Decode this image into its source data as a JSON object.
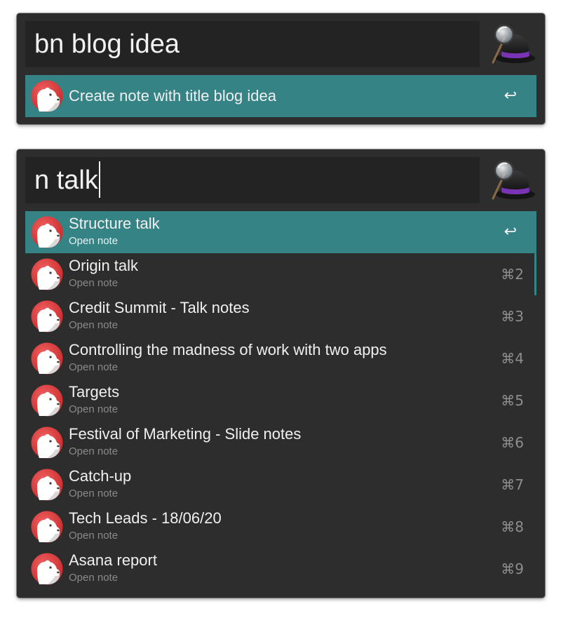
{
  "panel1": {
    "query": "bn blog idea",
    "result": {
      "title": "Create note with title blog idea",
      "shortcut": "↩"
    }
  },
  "panel2": {
    "query": "n talk",
    "results": [
      {
        "title": "Structure talk",
        "subtitle": "Open note",
        "shortcut": "↩",
        "selected": true
      },
      {
        "title": "Origin talk",
        "subtitle": "Open note",
        "shortcut": "⌘2"
      },
      {
        "title": "Credit Summit - Talk notes",
        "subtitle": "Open note",
        "shortcut": "⌘3"
      },
      {
        "title": "Controlling the madness of work with two apps",
        "subtitle": "Open note",
        "shortcut": "⌘4"
      },
      {
        "title": "Targets",
        "subtitle": "Open note",
        "shortcut": "⌘5"
      },
      {
        "title": "Festival of Marketing - Slide notes",
        "subtitle": "Open note",
        "shortcut": "⌘6"
      },
      {
        "title": "Catch-up",
        "subtitle": "Open note",
        "shortcut": "⌘7"
      },
      {
        "title": "Tech Leads - 18/06/20",
        "subtitle": "Open note",
        "shortcut": "⌘8"
      },
      {
        "title": "Asana report",
        "subtitle": "Open note",
        "shortcut": "⌘9"
      }
    ]
  },
  "colors": {
    "selection": "#368386",
    "window_bg": "#2d2d2d",
    "field_bg": "#232323",
    "bear_red": "#dd3b3b",
    "hat_purple": "#7a33b5"
  },
  "icons": {
    "app": "alfred-hat-icon",
    "result": "bear-app-icon"
  }
}
